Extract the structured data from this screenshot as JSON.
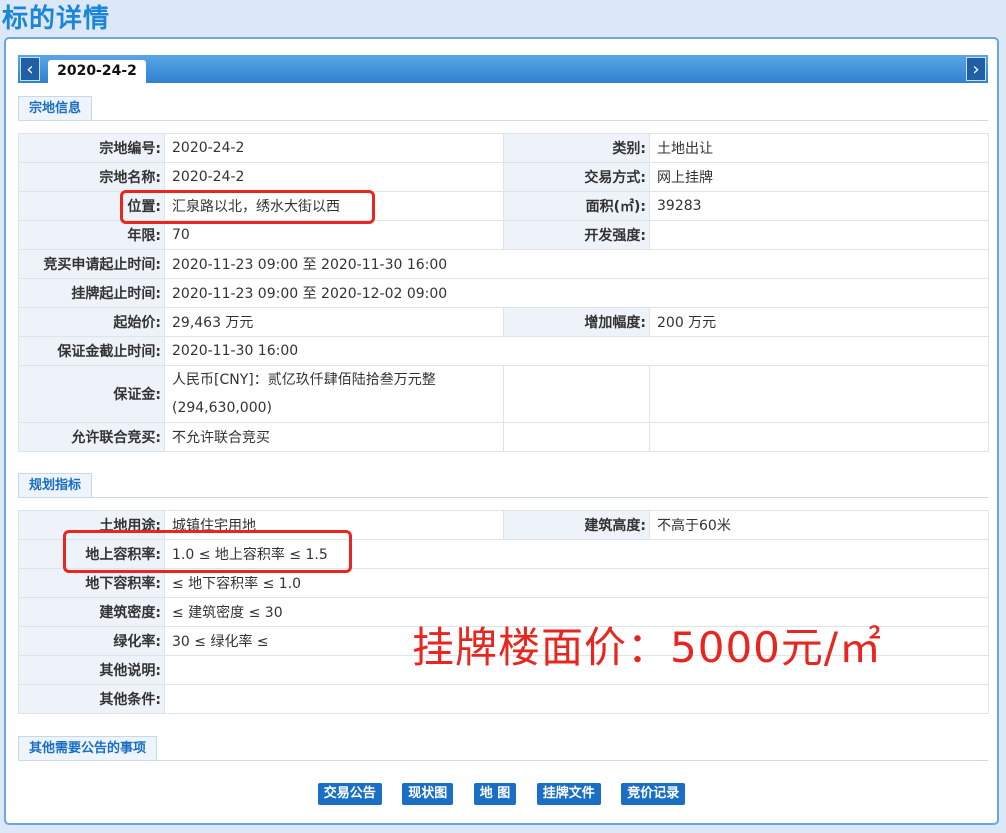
{
  "page_title": "标的详情",
  "tabs": {
    "active": "2020-24-2",
    "prev_icon": "chevron-left-icon",
    "next_icon": "chevron-right-icon"
  },
  "sections": {
    "land_info": "宗地信息",
    "planning": "规划指标",
    "other": "其他需要公告的事项"
  },
  "land_info": {
    "parcel_no": {
      "label": "宗地编号:",
      "value": "2020-24-2"
    },
    "category": {
      "label": "类别:",
      "value": "土地出让"
    },
    "parcel_name": {
      "label": "宗地名称:",
      "value": "2020-24-2"
    },
    "trade_mode": {
      "label": "交易方式:",
      "value": "网上挂牌"
    },
    "location": {
      "label": "位置:",
      "value": "汇泉路以北，绣水大街以西"
    },
    "area": {
      "label": "面积(㎡):",
      "value": "39283"
    },
    "term": {
      "label": "年限:",
      "value": "70"
    },
    "dev_intensity": {
      "label": "开发强度:",
      "value": ""
    },
    "apply_period": {
      "label": "竞买申请起止时间:",
      "value": "2020-11-23 09:00 至 2020-11-30 16:00"
    },
    "listing_period": {
      "label": "挂牌起止时间:",
      "value": "2020-11-23 09:00 至 2020-12-02 09:00"
    },
    "start_price": {
      "label": "起始价:",
      "value": "29,463 万元"
    },
    "increment": {
      "label": "增加幅度:",
      "value": "200 万元"
    },
    "deposit_deadline": {
      "label": "保证金截止时间:",
      "value": "2020-11-30 16:00"
    },
    "deposit": {
      "label": "保证金:",
      "value_line1": "人民币[CNY]：贰亿玖仟肆佰陆拾叁万元整",
      "value_line2": "(294,630,000)"
    },
    "joint_bid": {
      "label": "允许联合竞买:",
      "value": "不允许联合竞买"
    }
  },
  "planning": {
    "land_use": {
      "label": "土地用途:",
      "value": "城镇住宅用地"
    },
    "height": {
      "label": "建筑高度:",
      "value": "不高于60米"
    },
    "far_above": {
      "label": "地上容积率:",
      "value": "1.0 ≤ 地上容积率 ≤ 1.5"
    },
    "far_below": {
      "label": "地下容积率:",
      "value": "≤ 地下容积率 ≤ 1.0"
    },
    "density": {
      "label": "建筑密度:",
      "value": "≤ 建筑密度 ≤ 30"
    },
    "green": {
      "label": "绿化率:",
      "value": "30 ≤ 绿化率 ≤"
    },
    "other_desc": {
      "label": "其他说明:",
      "value": ""
    },
    "other_cond": {
      "label": "其他条件:",
      "value": ""
    }
  },
  "annotation_text": "挂牌楼面价：5000元/㎡",
  "annotation_color": "#e8261f",
  "buttons": {
    "notice": "交易公告",
    "status_map": "现状图",
    "map": "地 图",
    "listing_docs": "挂牌文件",
    "bid_record": "竞价记录"
  }
}
